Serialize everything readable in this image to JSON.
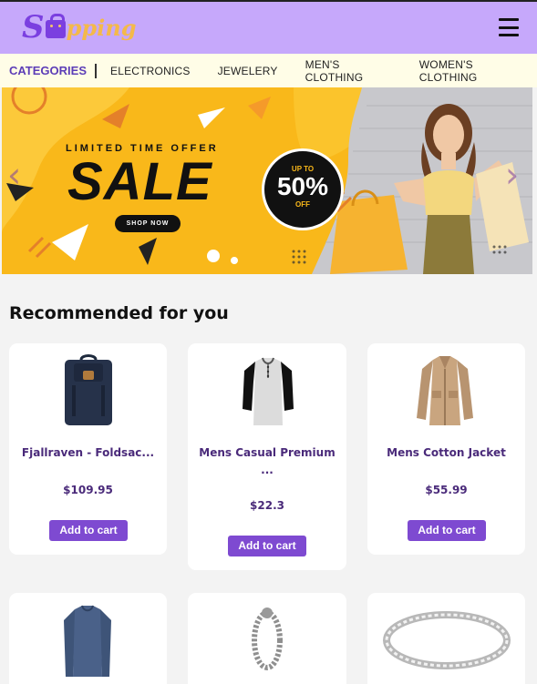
{
  "header": {
    "logo_initial": "S",
    "logo_rest": "pping",
    "menu_icon": "hamburger-menu-icon"
  },
  "categories": {
    "title": "CATEGORIES",
    "items": [
      "ELECTRONICS",
      "JEWELERY",
      "MEN'S CLOTHING",
      "WOMEN'S CLOTHING"
    ]
  },
  "banner": {
    "limited": "LIMITED TIME OFFER",
    "sale": "SALE",
    "shop_now": "SHOP NOW",
    "up_to": "UP TO",
    "percent": "50%",
    "off": "OFF",
    "prev_icon": "chevron-left-icon",
    "next_icon": "chevron-right-icon"
  },
  "recommended": {
    "title": "Recommended for you",
    "add_label": "Add to cart",
    "products": [
      {
        "name": "Fjallraven - Foldsac...",
        "price": "$109.95"
      },
      {
        "name_line1": "Mens Casual Premium",
        "name_line2": "...",
        "price": "$22.3"
      },
      {
        "name": "Mens Cotton Jacket",
        "price": "$55.99"
      }
    ]
  },
  "colors": {
    "header_bg": "#c6a8fb",
    "category_bar_bg": "#fffde7",
    "accent": "#7e4ad1",
    "banner_yellow": "#f9b81a",
    "product_text": "#4a2a7a"
  }
}
